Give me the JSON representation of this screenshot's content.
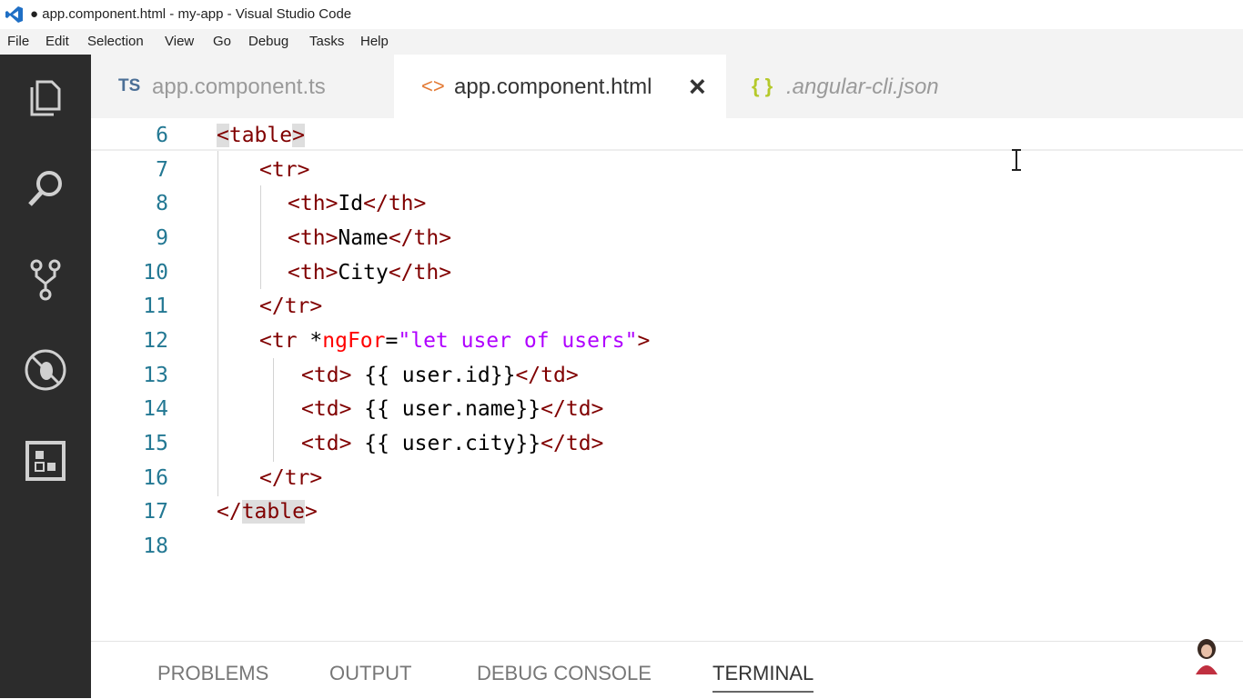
{
  "window": {
    "title": "● app.component.html - my-app - Visual Studio Code"
  },
  "menu": [
    "File",
    "Edit",
    "Selection",
    "View",
    "Go",
    "Debug",
    "Tasks",
    "Help"
  ],
  "tabs": [
    {
      "icon_text": "TS",
      "icon": "typescript-icon",
      "label": "app.component.ts",
      "active": false
    },
    {
      "icon_text": "<>",
      "icon": "html-icon",
      "label": "app.component.html",
      "active": true,
      "close": "×"
    },
    {
      "icon_text": "{ }",
      "icon": "json-icon",
      "label": ".angular-cli.json",
      "active": false
    }
  ],
  "activity_bar": [
    "explorer-icon",
    "search-icon",
    "source-control-icon",
    "debug-icon",
    "extensions-icon"
  ],
  "editor": {
    "lines": [
      {
        "n": "6"
      },
      {
        "n": "7"
      },
      {
        "n": "8"
      },
      {
        "n": "9"
      },
      {
        "n": "10"
      },
      {
        "n": "11"
      },
      {
        "n": "12"
      },
      {
        "n": "13"
      },
      {
        "n": "14"
      },
      {
        "n": "15"
      },
      {
        "n": "16"
      },
      {
        "n": "17"
      },
      {
        "n": "18"
      }
    ],
    "tokens": {
      "l6": [
        "<",
        "table",
        ">"
      ],
      "l7": [
        "<",
        "tr",
        ">"
      ],
      "l8": [
        "<",
        "th",
        ">",
        "Id",
        "</",
        "th",
        ">"
      ],
      "l9": [
        "<",
        "th",
        ">",
        "Name",
        "</",
        "th",
        ">"
      ],
      "l10": [
        "<",
        "th",
        ">",
        "City",
        "</",
        "th",
        ">"
      ],
      "l11": [
        "</",
        "tr",
        ">"
      ],
      "l12": [
        "<",
        "tr",
        " *",
        "ngFor",
        "=",
        "\"let user of users\"",
        ">"
      ],
      "l13": [
        "<",
        "td",
        "> ",
        "{{ user.id}}",
        "</",
        "td",
        ">"
      ],
      "l14": [
        "<",
        "td",
        "> ",
        "{{ user.name}}",
        "</",
        "td",
        ">"
      ],
      "l15": [
        "<",
        "td",
        "> ",
        "{{ user.city}}",
        "</",
        "td",
        ">"
      ],
      "l16": [
        "</",
        "tr",
        ">"
      ],
      "l17": [
        "</",
        "table",
        ">"
      ]
    }
  },
  "panel": {
    "tabs": [
      "PROBLEMS",
      "OUTPUT",
      "DEBUG CONSOLE",
      "TERMINAL"
    ],
    "active": "TERMINAL"
  },
  "colors": {
    "activity_bar": "#2c2c2c",
    "tag": "#800000",
    "attribute": "#ff0000",
    "string": "#0000ff",
    "line_number": "#237893"
  }
}
